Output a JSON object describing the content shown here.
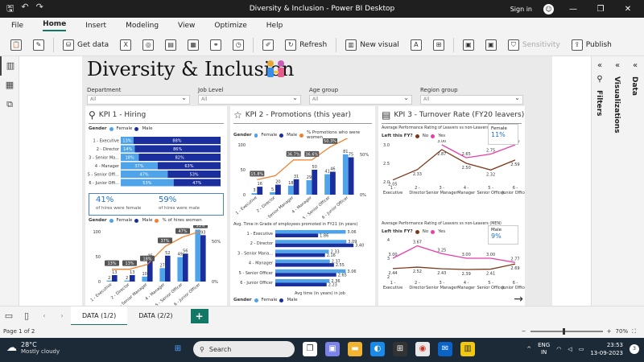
{
  "window": {
    "title": "Diversity & Inclusion - Power BI Desktop",
    "signin": "Sign in"
  },
  "menu": [
    "File",
    "Home",
    "Insert",
    "Modeling",
    "View",
    "Optimize",
    "Help"
  ],
  "ribbon": {
    "get_data": "Get data",
    "refresh": "Refresh",
    "new_visual": "New visual",
    "sensitivity": "Sensitivity",
    "publish": "Publish"
  },
  "report": {
    "title": "Diversity & Inclusion"
  },
  "slicers": [
    {
      "label": "Department",
      "value": "All"
    },
    {
      "label": "Job Level",
      "value": "All"
    },
    {
      "label": "Age group",
      "value": "All"
    },
    {
      "label": "Region group",
      "value": "All"
    }
  ],
  "kpi1": {
    "title": "KPI 1 - Hiring",
    "legend_label": "Gender",
    "legend": [
      "Female",
      "Male"
    ],
    "combo_legend": [
      "Female",
      "Male",
      "% of hires women"
    ],
    "female_pct": "41%",
    "female_text": "of hires were female",
    "male_pct": "59%",
    "male_text": "of hires were male"
  },
  "kpi2": {
    "title": "KPI 2 - Promotions (this year)",
    "legend_label": "Gender",
    "legend": [
      "Female",
      "Male",
      "% Promotions who were women"
    ],
    "bar_title": "Avg. Time in Grade of employees promoted in FY21 (in years)",
    "bar_xlabel": "Avg time (in years) in job"
  },
  "kpi3": {
    "title": "KPI 3 - Turnover Rate (FY20 leavers)",
    "chart1_title": "Average Performance Rating of Leavers vs non-Leavers (WOMEN)",
    "chart2_title": "Average Performance Rating of Leavers vs non-Leavers (MEN)",
    "legend_label": "Left this FY?",
    "legend": [
      "No",
      "Yes"
    ],
    "female_card": {
      "label": "Female",
      "value": "11%"
    },
    "male_card": {
      "label": "Male",
      "value": "9%"
    }
  },
  "tabs": [
    "DATA (1/2)",
    "DATA (2/2)"
  ],
  "status": {
    "page": "Page 1 of 2",
    "zoom": "70%"
  },
  "panes": {
    "filters": "Filters",
    "visualizations": "Visualizations",
    "data": "Data"
  },
  "taskbar": {
    "temp": "28°C",
    "weather": "Mostly cloudy",
    "search": "Search",
    "lang1": "ENG",
    "lang2": "IN",
    "time": "23:53",
    "date": "13-09-2023",
    "notifications": "3"
  },
  "colors": {
    "female": "#4fa3e8",
    "male": "#1a2e9e",
    "pct_line": "#f08030",
    "no_line": "#7a3a1a",
    "yes_line": "#e83ea8",
    "accent": "#117865"
  },
  "chart_data": [
    {
      "type": "bar",
      "name": "hiring_share",
      "categories": [
        "1 - Executive",
        "2 - Director",
        "3 - Senior Ma...",
        "4 - Manager",
        "5 - Senior Offi...",
        "6 - Junior Offi..."
      ],
      "series": [
        {
          "name": "Female",
          "values": [
            13,
            14,
            18,
            37,
            47,
            53
          ]
        },
        {
          "name": "Male",
          "values": [
            88,
            86,
            82,
            63,
            53,
            47
          ]
        }
      ],
      "value_labels": {
        "Female": [
          "13%",
          "14%",
          "18%",
          "37%",
          "47%",
          "53%"
        ],
        "Male": [
          "88%",
          "86%",
          "82%",
          "63%",
          "53%",
          "47%"
        ]
      }
    },
    {
      "type": "bar",
      "name": "hiring_counts",
      "categories": [
        "1 - Executive",
        "2 - Director",
        "3 - Senior Manager",
        "4 - Manager",
        "5 - Senior Officer",
        "6 - Junior Officer"
      ],
      "series": [
        {
          "name": "Female",
          "values": [
            2,
            2,
            10,
            27,
            49,
            104
          ]
        },
        {
          "name": "Male",
          "values": [
            13,
            13,
            46,
            52,
            56,
            93
          ]
        },
        {
          "name": "% of hires women",
          "values": [
            13,
            13,
            18,
            37,
            47,
            53
          ]
        }
      ],
      "line_labels": [
        "13%",
        "13%",
        "18%",
        "37%",
        "47%",
        "53%"
      ],
      "ylim": [
        0,
        100
      ],
      "y2lim": [
        0,
        50
      ],
      "yticks": [
        0,
        50,
        100
      ],
      "y2ticks": [
        "0%",
        "50%"
      ]
    },
    {
      "type": "bar",
      "name": "promotions",
      "categories": [
        "1 - Executive",
        "2 - Director",
        "3 - Senior Manager",
        "4 - Manager",
        "5 - Senior Officer",
        "6 - Junior Officer"
      ],
      "series": [
        {
          "name": "Female",
          "values": [
            3,
            5,
            18,
            29,
            41,
            81
          ]
        },
        {
          "name": "Male",
          "values": [
            16,
            20,
            31,
            50,
            46,
            75
          ]
        },
        {
          "name": "% Promotions who were women",
          "values": [
            15.8,
            20,
            36.7,
            36.6,
            50.3,
            60
          ]
        }
      ],
      "line_labels": [
        "15.8%",
        "",
        "36.7%",
        "36.6%",
        "50.3%",
        ""
      ],
      "ylim": [
        0,
        100
      ],
      "y2lim": [
        0,
        50
      ],
      "yticks": [
        0,
        50,
        100
      ],
      "y2ticks": [
        "0%",
        "50%"
      ]
    },
    {
      "type": "bar",
      "name": "time_in_grade",
      "categories": [
        "1 - Executive",
        "2 - Director",
        "3 - Senior Mana...",
        "4 - Manager",
        "5 - Senior Officer",
        "6 - Junior Officer"
      ],
      "series": [
        {
          "name": "Female",
          "values": [
            3.06,
            3.09,
            2.33,
            2.37,
            3.06,
            2.36
          ]
        },
        {
          "name": "Male",
          "values": [
            1.86,
            3.4,
            2.16,
            2.55,
            2.65,
            2.23
          ]
        }
      ],
      "xlabel": "Avg time (in years) in job"
    },
    {
      "type": "line",
      "name": "turnover_women",
      "categories": [
        "1 - Executive",
        "2 - Director",
        "3 - Senior Manager",
        "4 - Manager",
        "5 - Senior Officer",
        "6 - Junior Officer"
      ],
      "series": [
        {
          "name": "No",
          "values": [
            2.05,
            2.33,
            2.87,
            2.5,
            2.32,
            2.59
          ]
        },
        {
          "name": "Yes",
          "values": [
            null,
            null,
            3.0,
            2.65,
            2.75,
            3.0
          ]
        }
      ],
      "ylim": [
        2.0,
        3.0
      ],
      "yticks": [
        2.0,
        2.5,
        3.0
      ]
    },
    {
      "type": "line",
      "name": "turnover_men",
      "categories": [
        "1 - Executive",
        "2 - Director",
        "3 - Senior Manager",
        "4 - Manager",
        "5 - Senior Officer",
        "6 - Junior Officer"
      ],
      "series": [
        {
          "name": "No",
          "values": [
            2.44,
            2.52,
            2.43,
            2.39,
            2.41,
            2.69
          ]
        },
        {
          "name": "Yes",
          "values": [
            3.0,
            3.67,
            3.25,
            3.0,
            3.0,
            2.77
          ]
        }
      ],
      "ylim": [
        2,
        4
      ],
      "yticks": [
        2,
        3,
        4
      ]
    }
  ]
}
